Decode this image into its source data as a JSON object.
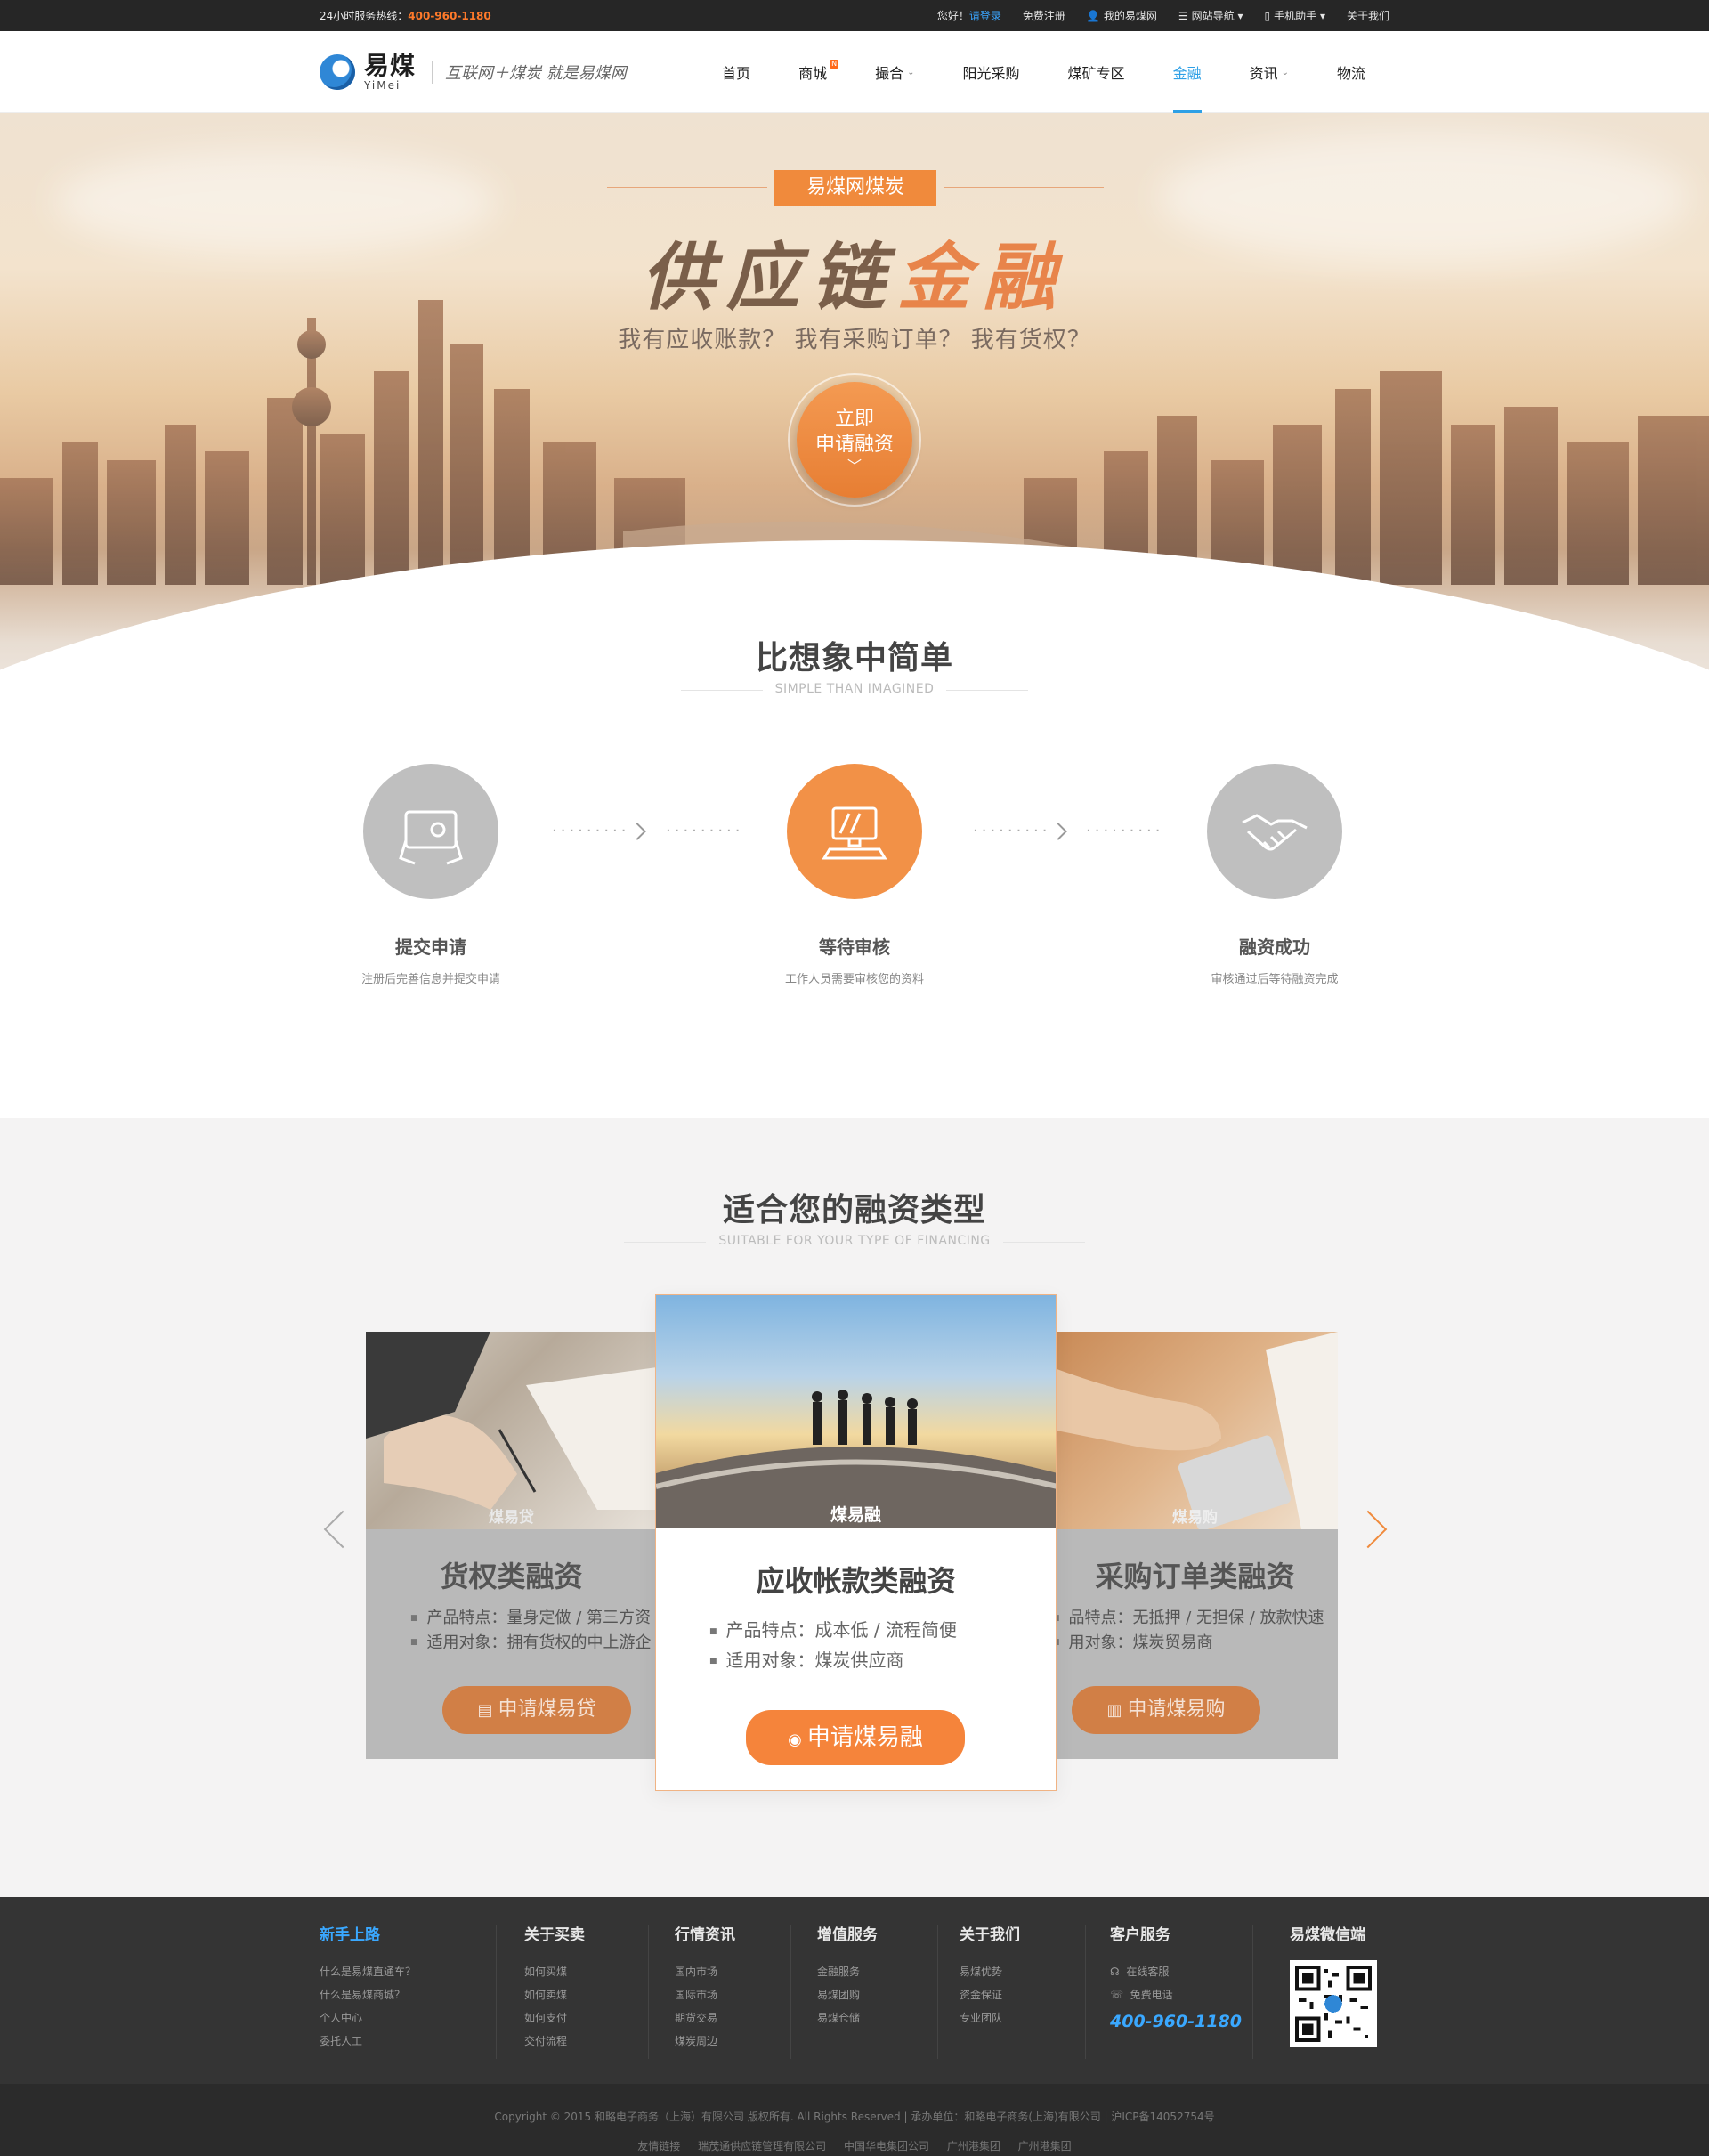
{
  "topbar": {
    "hotline_label": "24小时服务热线：",
    "hotline_number": "400-960-1180",
    "greeting": "您好！",
    "login": "请登录",
    "register": "免费注册",
    "my_account": "我的易煤网",
    "site_nav": "网站导航",
    "mobile": "手机助手",
    "about": "关于我们"
  },
  "header": {
    "logo_cn": "易煤",
    "logo_en": "YiMei",
    "slogan": "互联网＋煤炭  就是易煤网",
    "nav": [
      {
        "label": "首页"
      },
      {
        "label": "商城"
      },
      {
        "label": "撮合"
      },
      {
        "label": "阳光采购"
      },
      {
        "label": "煤矿专区"
      },
      {
        "label": "金融"
      },
      {
        "label": "资讯"
      },
      {
        "label": "物流"
      }
    ],
    "new_badge": "N"
  },
  "hero": {
    "tag": "易煤网煤炭",
    "title_a": "供应链",
    "title_b": "金融",
    "subtitle": "我有应收账款？  我有采购订单？  我有货权？",
    "apply_line1": "立即",
    "apply_line2": "申请融资",
    "apply_chevron": "﹀"
  },
  "simple": {
    "title": "比想象中简单",
    "subtitle": "SIMPLE THAN IMAGINED",
    "steps": [
      {
        "name": "提交申请",
        "desc": "注册后完善信息并提交申请"
      },
      {
        "name": "等待审核",
        "desc": "工作人员需要审核您的资料"
      },
      {
        "name": "融资成功",
        "desc": "审核通过后等待融资完成"
      }
    ]
  },
  "types": {
    "title": "适合您的融资类型",
    "subtitle": "SUITABLE FOR YOUR TYPE OF FINANCING",
    "left": {
      "photo_label": "煤易贷",
      "title": "货权类融资",
      "feat1": "产品特点：量身定做 / 第三方资",
      "feat2": "适用对象：拥有货权的中上游企",
      "button": "申请煤易贷"
    },
    "center": {
      "photo_label": "煤易融",
      "title": "应收帐款类融资",
      "feat1": "产品特点：成本低 / 流程简便",
      "feat2": "适用对象：煤炭供应商",
      "button": "申请煤易融"
    },
    "right": {
      "photo_label": "煤易购",
      "title": "采购订单类融资",
      "feat1": "品特点：无抵押 / 无担保 / 放款快速",
      "feat2": "用对象：煤炭贸易商",
      "button": "申请煤易购"
    }
  },
  "footer": {
    "cols": [
      {
        "title": "新手上路",
        "links": [
          "什么是易煤直通车？",
          "什么是易煤商城？",
          "个人中心",
          "委托人工"
        ]
      },
      {
        "title": "关于买卖",
        "links": [
          "如何买煤",
          "如何卖煤",
          "如何支付",
          "交付流程"
        ]
      },
      {
        "title": "行情资讯",
        "links": [
          "国内市场",
          "国际市场",
          "期货交易",
          "煤炭周边"
        ]
      },
      {
        "title": "增值服务",
        "links": [
          "金融服务",
          "易煤团购",
          "易煤仓储"
        ]
      },
      {
        "title": "关于我们",
        "links": [
          "易煤优势",
          "资金保证",
          "专业团队"
        ]
      }
    ],
    "service_title": "客户服务",
    "service_online": "在线客服",
    "service_phone_label": "免费电话",
    "service_phone": "400-960-1180",
    "wechat_title": "易煤微信端",
    "copyright": "Copyright © 2015 和略电子商务（上海）有限公司 版权所有. All Rights Reserved    |    承办单位：和略电子商务(上海)有限公司    |    沪ICP备14052754号",
    "friend_label": "友情链接",
    "friends": [
      "瑞茂通供应链管理有限公司",
      "中国华电集团公司",
      "广州港集团",
      "广州港集团"
    ]
  }
}
